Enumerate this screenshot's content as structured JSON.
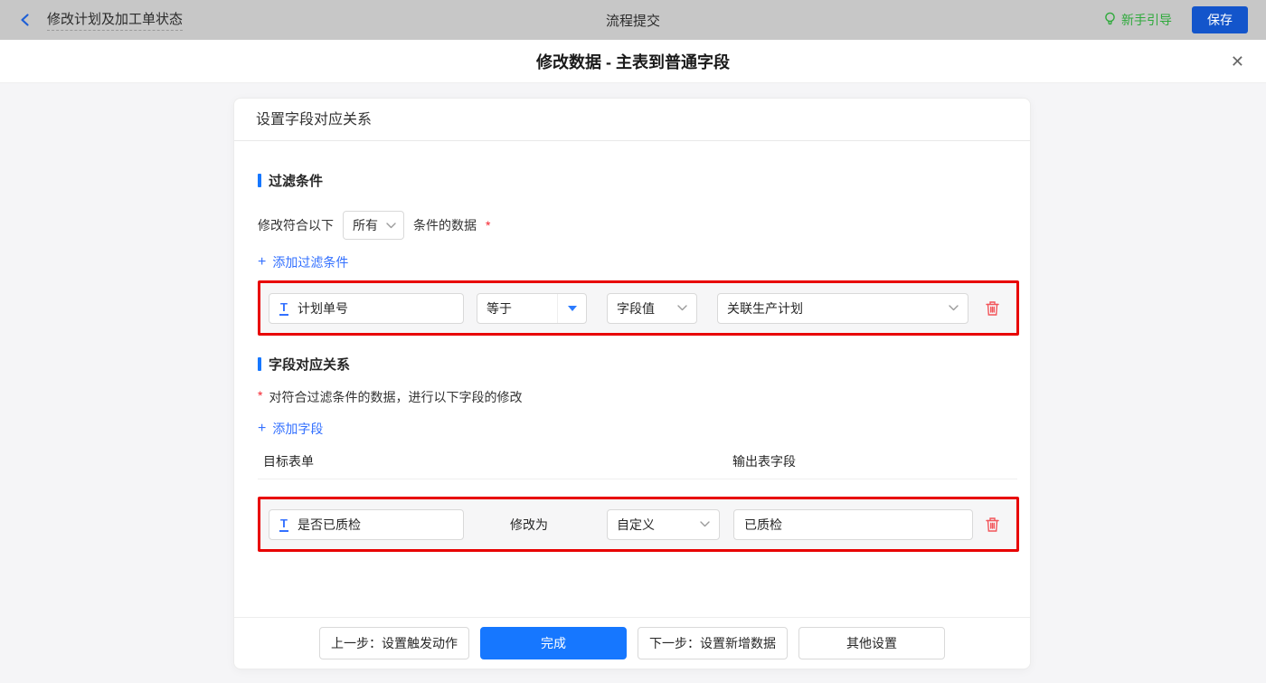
{
  "colors": {
    "accent_blue": "#1677ff",
    "link_blue": "#3370ff",
    "topbar_bg": "#c7c7c7",
    "save_blue": "#1355cb",
    "guide_green": "#2faa3c",
    "highlight_red": "#e80000",
    "danger_red": "#f2555a",
    "asterisk_red": "#f5222d",
    "back_blue": "#1e5fd6"
  },
  "topbar": {
    "back_title": "修改计划及加工单状态",
    "center_title": "流程提交",
    "guide_label": "新手引导",
    "save_label": "保存"
  },
  "modal": {
    "title": "修改数据 - 主表到普通字段",
    "close_glyph": "✕"
  },
  "panel": {
    "header_title": "设置字段对应关系",
    "filter": {
      "section_title": "过滤条件",
      "match_prefix": "修改符合以下",
      "match_mode": "所有",
      "match_suffix": "条件的数据",
      "required_mark": "*",
      "plus_glyph": "+",
      "add_label": "添加过滤条件",
      "row": {
        "field_icon": "T",
        "field": "计划单号",
        "operator": "等于",
        "value_type": "字段值",
        "value": "关联生产计划"
      }
    },
    "mapping": {
      "section_title": "字段对应关系",
      "required_mark": "*",
      "description": "对符合过滤条件的数据，进行以下字段的修改",
      "plus_glyph": "+",
      "add_label": "添加字段",
      "columns": {
        "target": "目标表单",
        "output": "输出表字段"
      },
      "row": {
        "field_icon": "T",
        "field": "是否已质检",
        "action_label": "修改为",
        "value_type": "自定义",
        "value": "已质检"
      }
    },
    "footer": {
      "prev": "上一步：设置触发动作",
      "done": "完成",
      "next": "下一步：设置新增数据",
      "other": "其他设置"
    }
  }
}
